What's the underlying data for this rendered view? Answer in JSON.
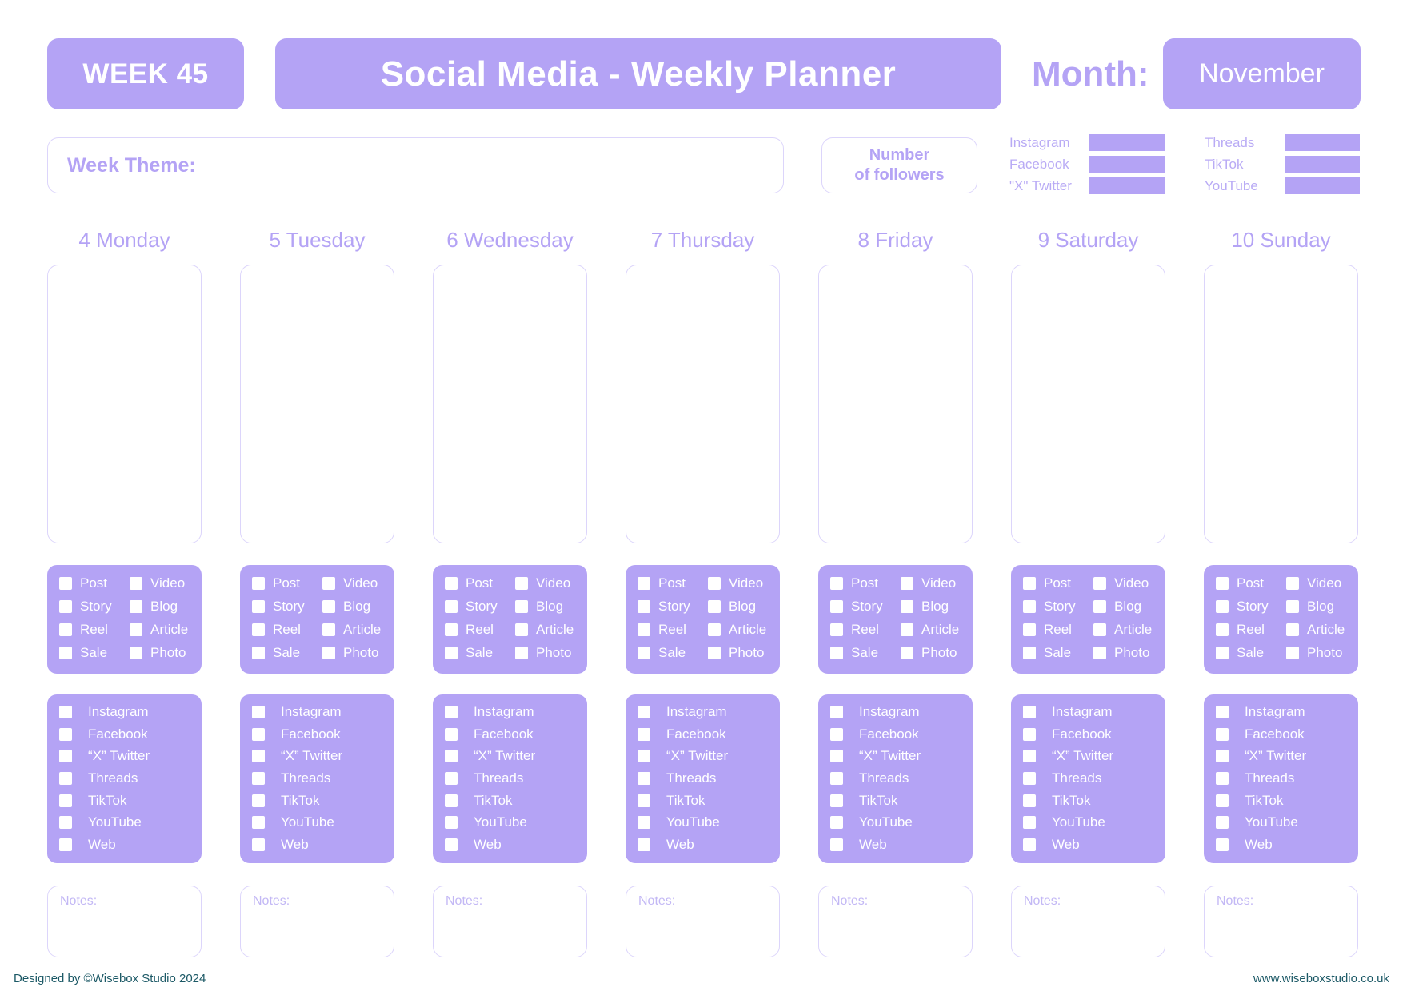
{
  "header": {
    "week_label": "WEEK 45",
    "title": "Social Media - Weekly Planner",
    "month_label": "Month:",
    "month_value": "November"
  },
  "week_theme": {
    "label": "Week Theme:"
  },
  "followers": {
    "label_line1": "Number",
    "label_line2": "of followers",
    "platforms_left": [
      "Instagram",
      "Facebook",
      "\"X\" Twitter"
    ],
    "platforms_right": [
      "Threads",
      "TikTok",
      "YouTube"
    ]
  },
  "days": [
    {
      "label": "4 Monday"
    },
    {
      "label": "5 Tuesday"
    },
    {
      "label": "6 Wednesday"
    },
    {
      "label": "7 Thursday"
    },
    {
      "label": "8 Friday"
    },
    {
      "label": "9 Saturday"
    },
    {
      "label": "10 Sunday"
    }
  ],
  "content_types": [
    "Post",
    "Video",
    "Story",
    "Blog",
    "Reel",
    "Article",
    "Sale",
    "Photo"
  ],
  "platforms": [
    "Instagram",
    "Facebook",
    "“X” Twitter",
    "Threads",
    "TikTok",
    "YouTube",
    "Web"
  ],
  "notes_label": "Notes:",
  "footer": {
    "left": "Designed by ©Wisebox Studio 2024",
    "right": "www.wiseboxstudio.co.uk"
  },
  "colors": {
    "accent": "#b4a3f5",
    "border": "#dcd5fb",
    "footer_text": "#1c5966"
  }
}
